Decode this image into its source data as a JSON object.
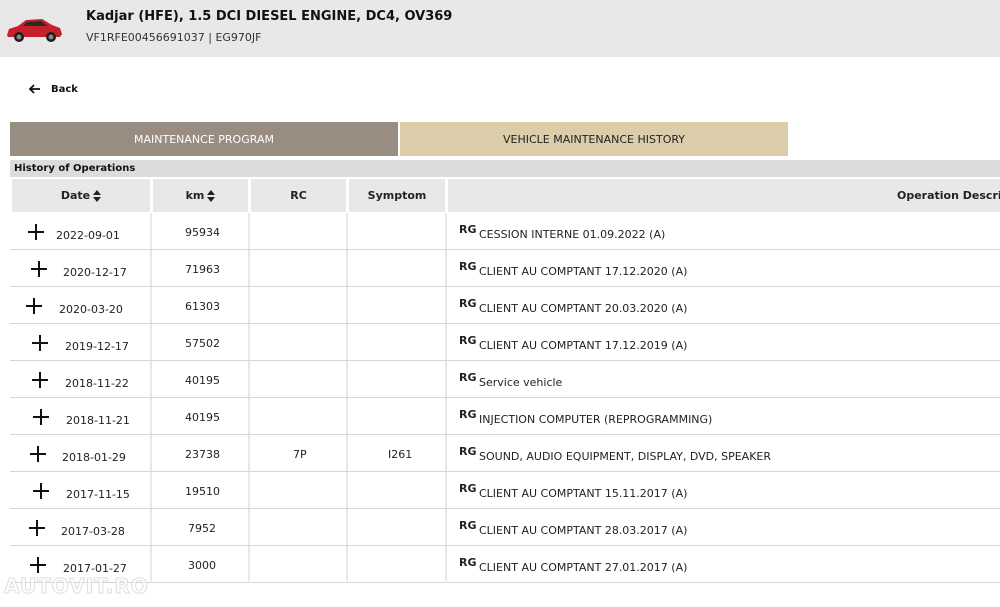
{
  "vehicle": {
    "title": "Kadjar (HFE), 1.5 DCI DIESEL ENGINE, DC4, OV369",
    "subtitle": "VF1RFE00456691037 | EG970JF"
  },
  "nav": {
    "back_label": "Back"
  },
  "tabs": [
    {
      "label": "MAINTENANCE PROGRAM",
      "color": "#998d81"
    },
    {
      "label": "VEHICLE MAINTENANCE HISTORY",
      "color": "#dccdaa"
    }
  ],
  "section": {
    "title": "History of Operations"
  },
  "table": {
    "headers": {
      "date": "Date",
      "km": "km",
      "rc": "RC",
      "symptom": "Symptom",
      "description": "Operation Descripti"
    },
    "rows": [
      {
        "date": "2022-09-01",
        "km": "95934",
        "rc": "",
        "symptom": "",
        "rg": "RG",
        "operation": "CESSION INTERNE 01.09.2022 (A)"
      },
      {
        "date": "2020-12-17",
        "km": "71963",
        "rc": "",
        "symptom": "",
        "rg": "RG",
        "operation": "CLIENT AU COMPTANT 17.12.2020 (A)"
      },
      {
        "date": "2020-03-20",
        "km": "61303",
        "rc": "",
        "symptom": "",
        "rg": "RG",
        "operation": "CLIENT AU COMPTANT 20.03.2020 (A)"
      },
      {
        "date": "2019-12-17",
        "km": "57502",
        "rc": "",
        "symptom": "",
        "rg": "RG",
        "operation": "CLIENT AU COMPTANT 17.12.2019 (A)"
      },
      {
        "date": "2018-11-22",
        "km": "40195",
        "rc": "",
        "symptom": "",
        "rg": "RG",
        "operation": "Service vehicle"
      },
      {
        "date": "2018-11-21",
        "km": "40195",
        "rc": "",
        "symptom": "",
        "rg": "RG",
        "operation": "INJECTION COMPUTER (REPROGRAMMING)"
      },
      {
        "date": "2018-01-29",
        "km": "23738",
        "rc": "7P",
        "symptom": "I261",
        "rg": "RG",
        "operation": "SOUND, AUDIO EQUIPMENT, DISPLAY, DVD, SPEAKER"
      },
      {
        "date": "2017-11-15",
        "km": "19510",
        "rc": "",
        "symptom": "",
        "rg": "RG",
        "operation": "CLIENT AU COMPTANT 15.11.2017 (A)"
      },
      {
        "date": "2017-03-28",
        "km": "7952",
        "rc": "",
        "symptom": "",
        "rg": "RG",
        "operation": "CLIENT AU COMPTANT 28.03.2017 (A)"
      },
      {
        "date": "2017-01-27",
        "km": "3000",
        "rc": "",
        "symptom": "",
        "rg": "RG",
        "operation": "CLIENT AU COMPTANT 27.01.2017 (A)"
      }
    ]
  },
  "watermark": {
    "text": "AUTOVIT.RO"
  },
  "icons": {
    "car": "car-icon",
    "back": "arrow-left-icon",
    "expand": "plus-icon",
    "sort": "sort-icon"
  }
}
